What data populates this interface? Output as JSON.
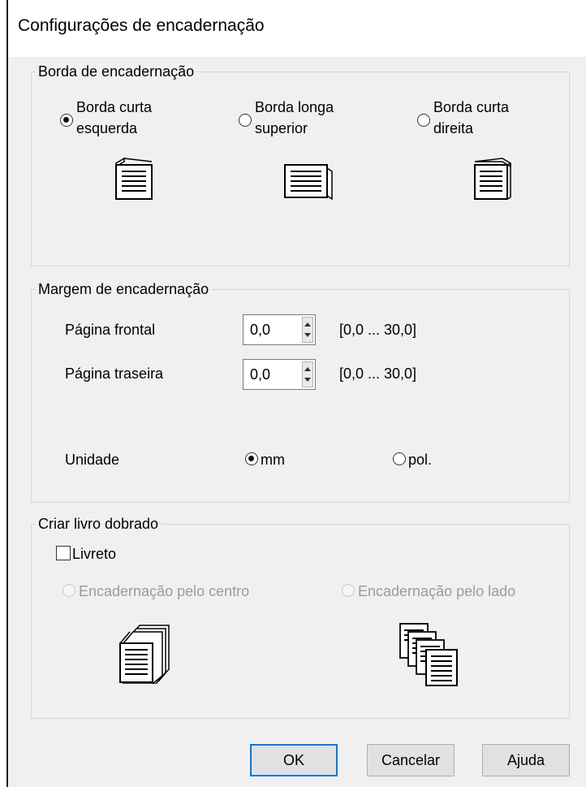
{
  "window": {
    "title": "Configurações de encadernação"
  },
  "binding_edge": {
    "legend": "Borda de encadernação",
    "selected": "short_left",
    "options": [
      {
        "line1": "Borda curta",
        "line2": "esquerda",
        "checked": true,
        "icon": "page-bound-left-icon"
      },
      {
        "line1": "Borda longa",
        "line2": "superior",
        "checked": false,
        "icon": "page-bound-top-icon"
      },
      {
        "line1": "Borda curta",
        "line2": "direita",
        "checked": false,
        "icon": "page-bound-right-icon"
      }
    ]
  },
  "binding_margin": {
    "legend": "Margem de encadernação",
    "front_label": "Página frontal",
    "front_value": "0,0",
    "front_range": "[0,0 ... 30,0]",
    "back_label": "Página traseira",
    "back_value": "0,0",
    "back_range": "[0,0 ... 30,0]",
    "unit_label": "Unidade",
    "unit_mm": "mm",
    "unit_in": "pol.",
    "selected_unit": "mm"
  },
  "folded_booklet": {
    "legend": "Criar livro dobrado",
    "booklet_label": "Livreto",
    "booklet_checked": false,
    "center_label": "Encadernação pelo centro",
    "side_label": "Encadernação pelo lado",
    "center_icon": "center-binding-booklet-icon",
    "side_icon": "side-binding-booklet-icon"
  },
  "buttons": {
    "ok": "OK",
    "cancel": "Cancelar",
    "help": "Ajuda"
  }
}
